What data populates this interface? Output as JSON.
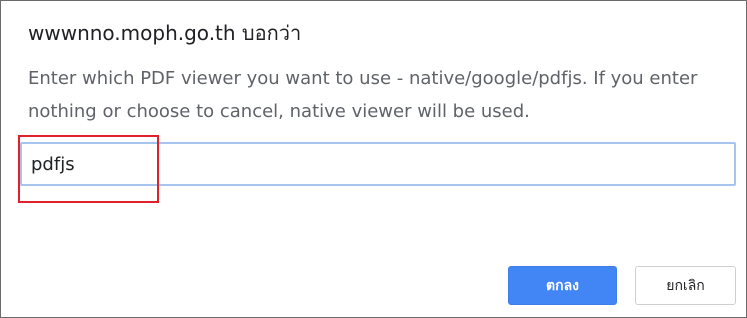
{
  "dialog": {
    "title": "wwwnno.moph.go.th บอกว่า",
    "message": "Enter which PDF viewer you want to use - native/google/pdfjs. If you enter nothing or choose to cancel, native viewer will be used.",
    "input_value": "pdfjs",
    "ok_label": "ตกลง",
    "cancel_label": "ยกเลิก"
  },
  "colors": {
    "ok_button": "#4285f4",
    "input_border": "#a7c4ee",
    "highlight": "#e0202a"
  }
}
